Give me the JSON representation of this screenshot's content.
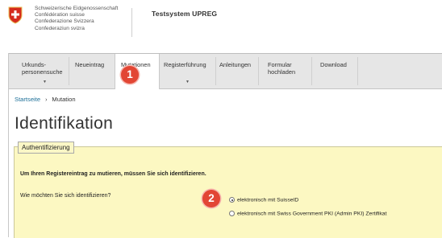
{
  "header": {
    "confederation_lines": [
      "Schweizerische Eidgenossenschaft",
      "Confédération suisse",
      "Confederazione Svizzera",
      "Confederaziun svizra"
    ],
    "system_title": "Testsystem UPREG"
  },
  "nav": {
    "items": [
      {
        "label_line1": "Urkunds-",
        "label_line2": "personensuche",
        "has_dropdown": true
      },
      {
        "label_line1": "Neueintrag",
        "label_line2": ""
      },
      {
        "label_line1": "Mutationen",
        "label_line2": "",
        "active": true
      },
      {
        "label_line1": "Registerführung",
        "label_line2": "",
        "has_dropdown": true
      },
      {
        "label_line1": "Anleitungen",
        "label_line2": ""
      },
      {
        "label_line1": "Formular",
        "label_line2": "hochladen"
      },
      {
        "label_line1": "Download",
        "label_line2": ""
      }
    ],
    "dropdown_caret": "▼"
  },
  "badges": [
    "1",
    "2"
  ],
  "breadcrumb": {
    "home": "Startseite",
    "separator": "›",
    "current": "Mutation"
  },
  "page_title": "Identifikation",
  "auth": {
    "legend": "Authentifizierung",
    "lead": "Um Ihren Registereintrag zu mutieren, müssen Sie sich identifizieren.",
    "question": "Wie möchten Sie sich identifizieren?",
    "options": [
      {
        "label": "elektronisch mit SuisseID",
        "selected": true
      },
      {
        "label": "elektronisch mit Swiss Government PKI (Admin PKI) Zertifikat",
        "selected": false
      }
    ]
  },
  "colors": {
    "accent_red": "#e24634",
    "panel_yellow": "#fcf8c2",
    "link_blue": "#1d6f98",
    "nav_grey": "#e6e6e6"
  }
}
